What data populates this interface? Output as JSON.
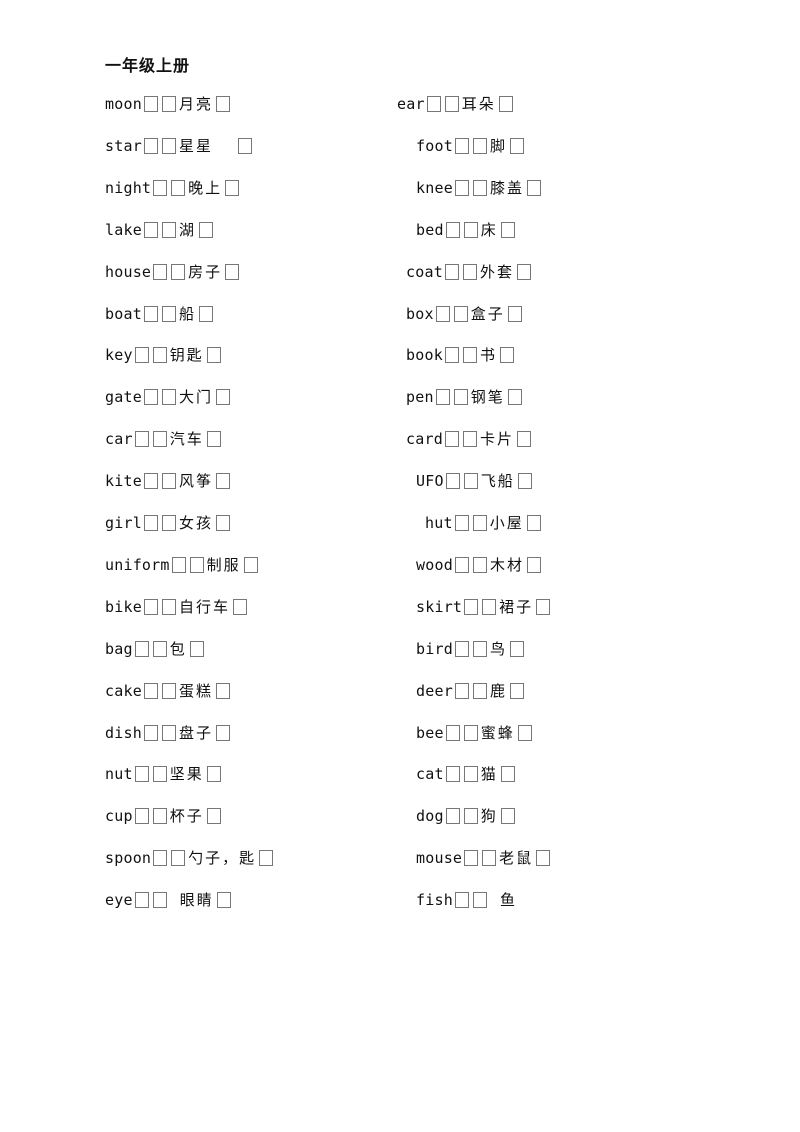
{
  "title": "一年级上册",
  "left_column": [
    {
      "word": "moon",
      "meaning": "月亮",
      "pre_gap": 0
    },
    {
      "word": "star",
      "meaning": "星星",
      "pre_gap": 0,
      "trailing_space": true
    },
    {
      "word": "night",
      "meaning": "晚上",
      "pre_gap": 0
    },
    {
      "word": "lake",
      "meaning": "湖",
      "pre_gap": 0
    },
    {
      "word": "house",
      "meaning": "房子",
      "pre_gap": 0
    },
    {
      "word": "boat",
      "meaning": "船",
      "pre_gap": 0
    },
    {
      "word": "key",
      "meaning": "钥匙",
      "pre_gap": 0
    },
    {
      "word": "gate",
      "meaning": "大门",
      "pre_gap": 0
    },
    {
      "word": "car",
      "meaning": "汽车",
      "pre_gap": 0
    },
    {
      "word": "kite",
      "meaning": "风筝",
      "pre_gap": 0
    },
    {
      "word": "girl",
      "meaning": "女孩",
      "pre_gap": 0
    },
    {
      "word": "uniform",
      "meaning": "制服",
      "pre_gap": 0
    },
    {
      "word": "bike",
      "meaning": "自行车",
      "pre_gap": 0
    },
    {
      "word": "bag",
      "meaning": "包",
      "pre_gap": 0
    },
    {
      "word": "cake",
      "meaning": "蛋糕",
      "pre_gap": 0
    },
    {
      "word": "dish",
      "meaning": "盘子",
      "pre_gap": 0
    },
    {
      "word": "nut",
      "meaning": "坚果",
      "pre_gap": 0
    },
    {
      "word": "cup",
      "meaning": "杯子",
      "pre_gap": 0
    },
    {
      "word": "spoon",
      "meaning": "勺子，匙",
      "pre_gap": 0
    },
    {
      "word": "eye",
      "meaning": "眼睛",
      "pre_gap": 0,
      "leading_space": true
    }
  ],
  "right_column": [
    {
      "word": "ear",
      "meaning": "耳朵"
    },
    {
      "word": "foot",
      "meaning": "脚"
    },
    {
      "word": "knee",
      "meaning": "膝盖"
    },
    {
      "word": "bed",
      "meaning": "床"
    },
    {
      "word": "coat",
      "meaning": "外套"
    },
    {
      "word": "box",
      "meaning": "盒子"
    },
    {
      "word": "book",
      "meaning": "书"
    },
    {
      "word": "pen",
      "meaning": "钢笔"
    },
    {
      "word": "card",
      "meaning": "卡片"
    },
    {
      "word": "UFO",
      "meaning": "飞船"
    },
    {
      "word": "hut",
      "meaning": "小屋"
    },
    {
      "word": "wood",
      "meaning": "木材"
    },
    {
      "word": "skirt",
      "meaning": "裙子"
    },
    {
      "word": "bird",
      "meaning": "鸟"
    },
    {
      "word": "deer",
      "meaning": "鹿"
    },
    {
      "word": "bee",
      "meaning": "蜜蜂"
    },
    {
      "word": "cat",
      "meaning": "猫"
    },
    {
      "word": "dog",
      "meaning": "狗"
    },
    {
      "word": "mouse",
      "meaning": "老鼠"
    },
    {
      "word": "fish",
      "meaning": "鱼",
      "leading_space": true,
      "no_trailing_box": true
    }
  ]
}
